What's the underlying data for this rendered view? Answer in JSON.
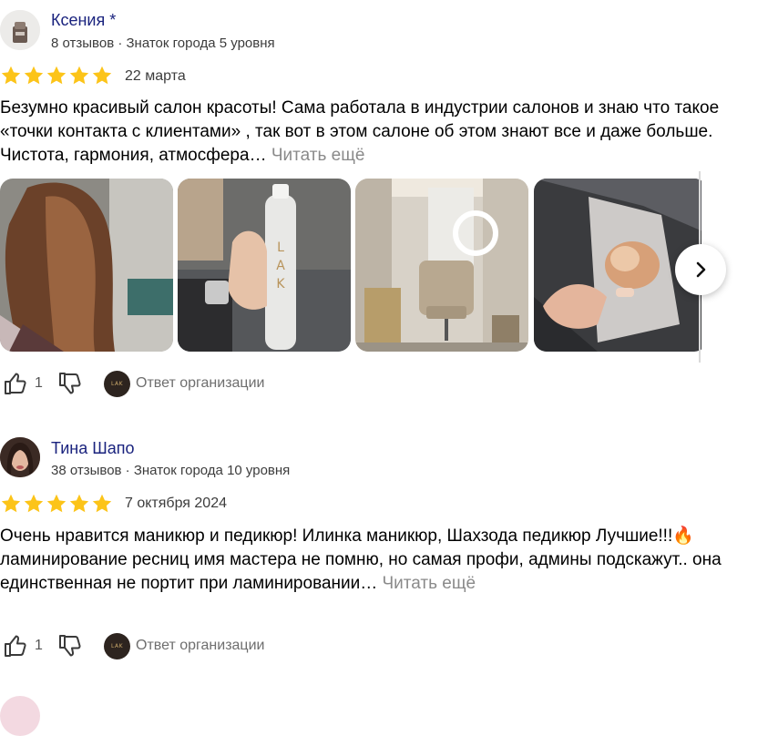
{
  "reviews": [
    {
      "author": "Ксения *",
      "meta": "8 отзывов · Знаток города 5 уровня",
      "rating": 5,
      "date": "22 марта",
      "text": "Безумно красивый салон красоты! Сама работала в индустрии салонов и знаю что такое «точки контакта с клиентами» , так вот в этом салоне об этом знают все и даже больше. Чистота, гармония, атмосфера…",
      "more": "Читать ещё",
      "likes": "1",
      "org_reply": "Ответ организации",
      "photo_count": 4
    },
    {
      "author": "Тина Шапо",
      "meta": "38 отзывов · Знаток города 10 уровня",
      "rating": 5,
      "date": "7 октября 2024",
      "text": "Очень нравится маникюр и педикюр! Илинка маникюр, Шахзода педикюр Лучшие!!!🔥 ламинирование ресниц имя мастера не помню, но самая профи, админы подскажут.. она единственная не портит при ламинировании…",
      "more": "Читать ещё",
      "likes": "1",
      "org_reply": "Ответ организации"
    }
  ],
  "org_logo_text": "LAK",
  "colors": {
    "author_name": "#1a237e",
    "star": "#fcc419",
    "muted": "#8a8a8a"
  },
  "icons": [
    "thumb-up-icon",
    "thumb-down-icon",
    "chevron-right-icon",
    "star-icon"
  ]
}
